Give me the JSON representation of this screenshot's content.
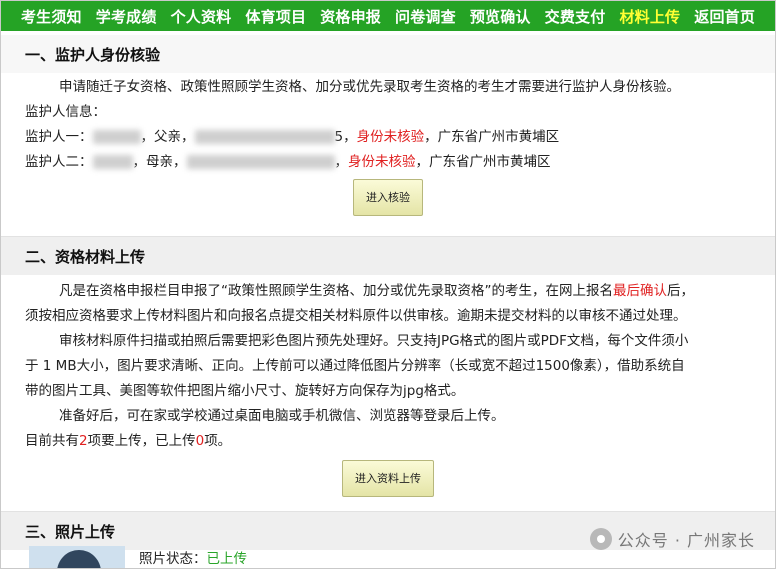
{
  "nav": {
    "items": [
      "考生须知",
      "学考成绩",
      "个人资料",
      "体育项目",
      "资格申报",
      "问卷调查",
      "预览确认",
      "交费支付",
      "材料上传",
      "返回首页"
    ],
    "active_index": 8,
    "bg_color": "#25a325",
    "active_color": "#ffff33"
  },
  "section1": {
    "title": "一、监护人身份核验",
    "intro": "申请随迁子女资格、政策性照顾学生资格、加分或优先录取考生资格的考生才需要进行监护人身份核验。",
    "info_label": "监护人信息：",
    "guardian1": {
      "label": "监护人一：",
      "relation": "，父亲，",
      "status": "身份未核验",
      "location": "，广东省广州市黄埔区",
      "id_suffix": "5"
    },
    "guardian2": {
      "label": "监护人二：",
      "relation": "，母亲，",
      "status": "身份未核验",
      "location": "，广东省广州市黄埔区",
      "id_suffix": ""
    },
    "button": "进入核验"
  },
  "section2": {
    "title": "二、资格材料上传",
    "p1_a": "凡是在资格申报栏目申报了“政策性照顾学生资格、加分或优先录取资格”的考生，在网上报名",
    "p1_red": "最后确认",
    "p1_b": "后，",
    "p1_c": "须按相应资格要求上传材料图片和向报名点提交相关材料原件以供审核。逾期未提交材料的以审核不通过处理。",
    "p2_a": "审核材料原件扫描或拍照后需要把彩色图片预先处理好。只支持JPG格式的图片或PDF文档，每个文件须小",
    "p2_b": "于 1 MB大小，图片要求清晰、正向。上传前可以通过降低图片分辨率（长或宽不超过1500像素），借助系统自",
    "p2_c": "带的图片工具、美图等软件把图片缩小尺寸、旋转好方向保存为jpg格式。",
    "p3": "准备好后，可在家或学校通过桌面电脑或手机微信、浏览器等登录后上传。",
    "count_a": "目前共有",
    "count_total": "2",
    "count_b": "项要上传，已上传",
    "count_done": "0",
    "count_c": "项。",
    "button": "进入资料上传"
  },
  "section3": {
    "title": "三、照片上传",
    "status_label": "照片状态：",
    "status_value": "已上传"
  },
  "watermark": "公众号 · 广州家长"
}
